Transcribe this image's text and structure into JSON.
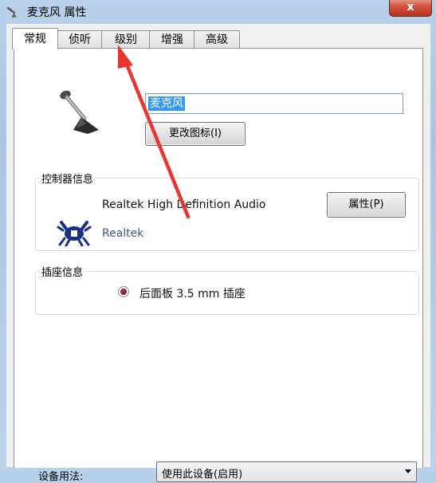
{
  "window": {
    "title": "麦克风 属性",
    "close_glyph": "x"
  },
  "tabs": [
    {
      "label": "常规",
      "active": true
    },
    {
      "label": "侦听",
      "active": false
    },
    {
      "label": "级别",
      "active": false
    },
    {
      "label": "增强",
      "active": false
    },
    {
      "label": "高级",
      "active": false
    }
  ],
  "device": {
    "icon": "microphone-icon",
    "name_value": "麦克风",
    "change_icon_button": "更改图标(I)"
  },
  "controller": {
    "group_label": "控制器信息",
    "name": "Realtek High Definition Audio",
    "vendor": "Realtek",
    "logo": "realtek-crab-logo",
    "properties_button": "属性(P)"
  },
  "jack": {
    "group_label": "插座信息",
    "description": "后面板 3.5 mm 插座",
    "color": "#8b1a3a"
  },
  "device_usage": {
    "label": "设备用法:",
    "selected": "使用此设备(启用)"
  },
  "annotation": {
    "arrow_color": "#e8362f",
    "points_to": "级别"
  }
}
